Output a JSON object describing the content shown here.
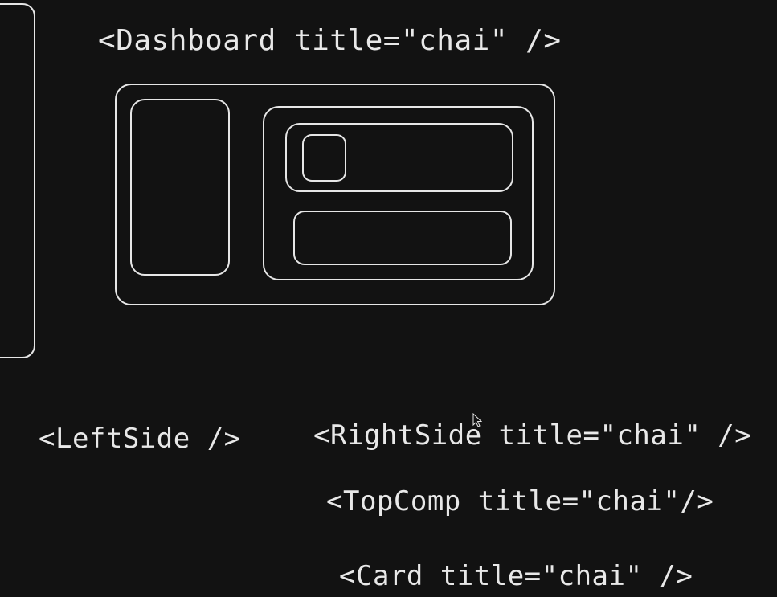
{
  "labels": {
    "dashboard": "<Dashboard title=\"chai\" />",
    "left_side": "<LeftSide />",
    "right_side": "<RightSide title=\"chai\" />",
    "top_comp": "<TopComp  title=\"chai\"/>",
    "card": "<Card title=\"chai\" />"
  },
  "colors": {
    "background": "#121212",
    "stroke": "#e6e6e6",
    "text": "#e8e8e8"
  },
  "icons": {
    "cursor": "mouse-pointer-icon"
  }
}
